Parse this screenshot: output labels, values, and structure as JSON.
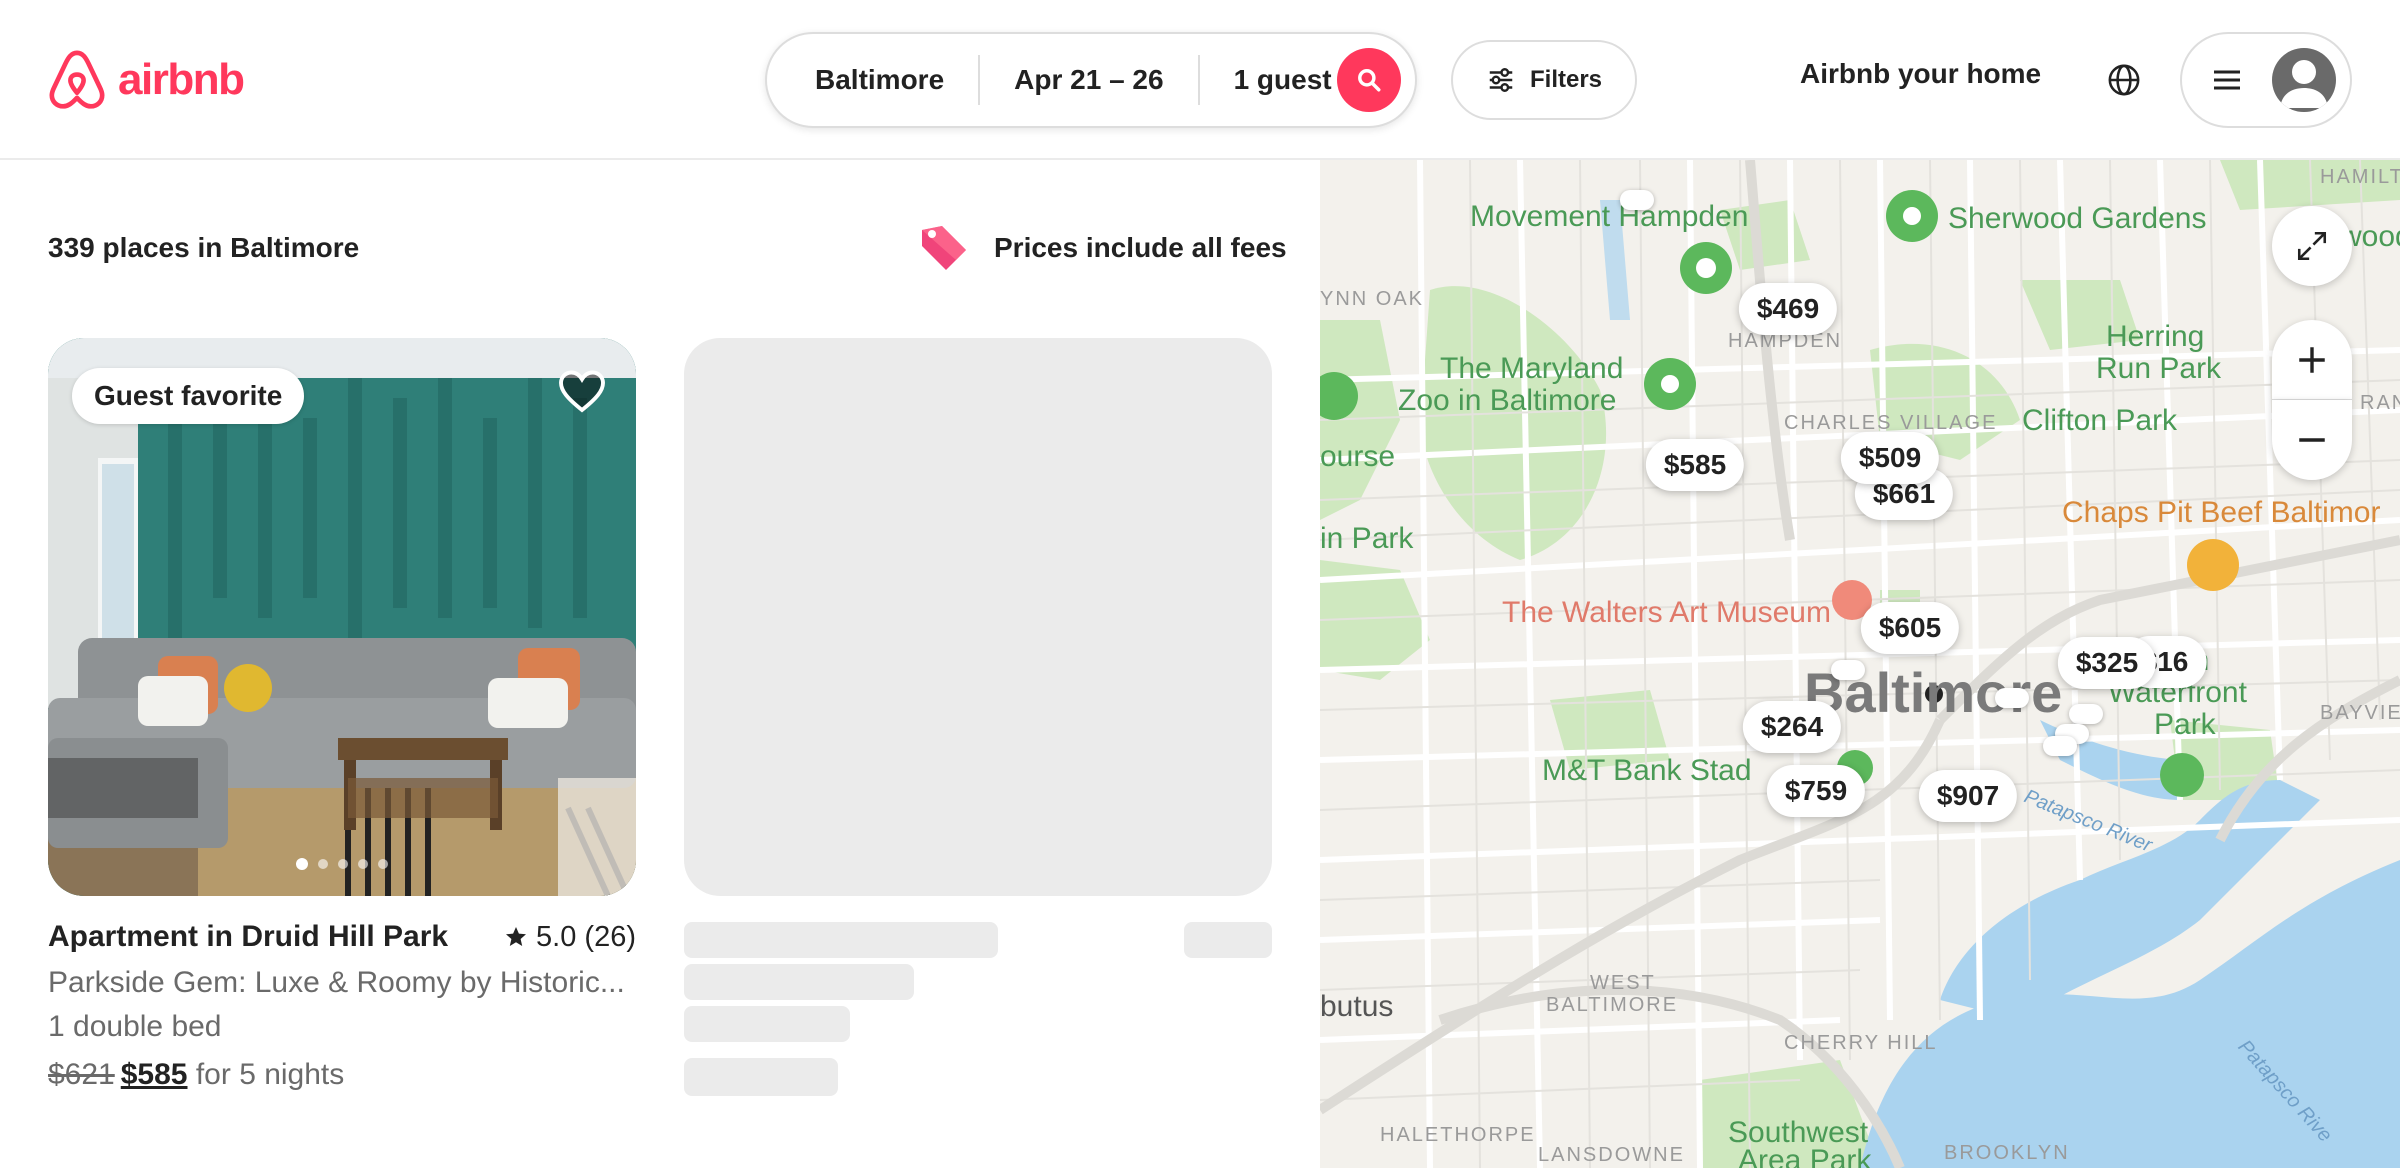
{
  "header": {
    "brand": "airbnb",
    "search": {
      "location": "Baltimore",
      "dates": "Apr 21 – 26",
      "guests": "1 guest"
    },
    "filters_label": "Filters",
    "host_link": "Airbnb your home"
  },
  "results": {
    "count_text": "339 places in Baltimore",
    "fees_note": "Prices include all fees"
  },
  "listing": {
    "badge": "Guest favorite",
    "title": "Apartment in Druid Hill Park",
    "rating": "5.0 (26)",
    "subtitle": "Parkside Gem: Luxe & Roomy by Historic...",
    "beds": "1 double bed",
    "price_original": "$621",
    "price_discounted": "$585",
    "price_suffix": "for 5 nights",
    "photo_count": 5,
    "active_photo": 1
  },
  "map": {
    "labels": {
      "hampden_area": "Movement Hampden",
      "sherwood": "Sherwood Gardens",
      "zoo_line1": "The Maryland",
      "zoo_line2": "Zoo in Baltimore",
      "herring_line1": "Herring",
      "herring_line2": "Run Park",
      "clifton": "Clifton Park",
      "chaps": "Chaps Pit Beef Baltimor",
      "walters": "The Walters Art Museum",
      "city": "Baltimore",
      "mt_bank": "M&T Bank Stad",
      "waterfront_line1": "on",
      "waterfront_line2": "Waterfront",
      "waterfront_line3": "Park",
      "southwest_line1": "Southwest",
      "southwest_line2": "Area Park",
      "wynn_oak": "YNN OAK",
      "hampden": "HAMPDEN",
      "charles_village": "CHARLES VILLAGE",
      "west_baltimore_line1": "WEST",
      "west_baltimore_line2": "BALTIMORE",
      "cherry_hill": "CHERRY HILL",
      "halethorpe": "HALETHORPE",
      "lansdowne": "LANSDOWNE",
      "brooklyn": "BROOKLYN",
      "bayview": "BAYVIEW",
      "hamilton": "HAMILTO",
      "rank": "RANK",
      "course": "ourse",
      "in_park": "in Park",
      "butus": "butus",
      "patapsco": "Patapsco River",
      "patapsco2": "Patapsco Rive",
      "hwood": "wood"
    },
    "price_pins": [
      {
        "label": "$469"
      },
      {
        "label": "$585"
      },
      {
        "label": "$509"
      },
      {
        "label": "$661"
      },
      {
        "label": "$605"
      },
      {
        "label": "$325"
      },
      {
        "label": "$16"
      },
      {
        "label": "$264"
      },
      {
        "label": "$759"
      },
      {
        "label": "$907"
      }
    ],
    "colors": {
      "accent": "#ff385c",
      "park": "#c8e6b4",
      "water": "#aad3ef"
    }
  }
}
